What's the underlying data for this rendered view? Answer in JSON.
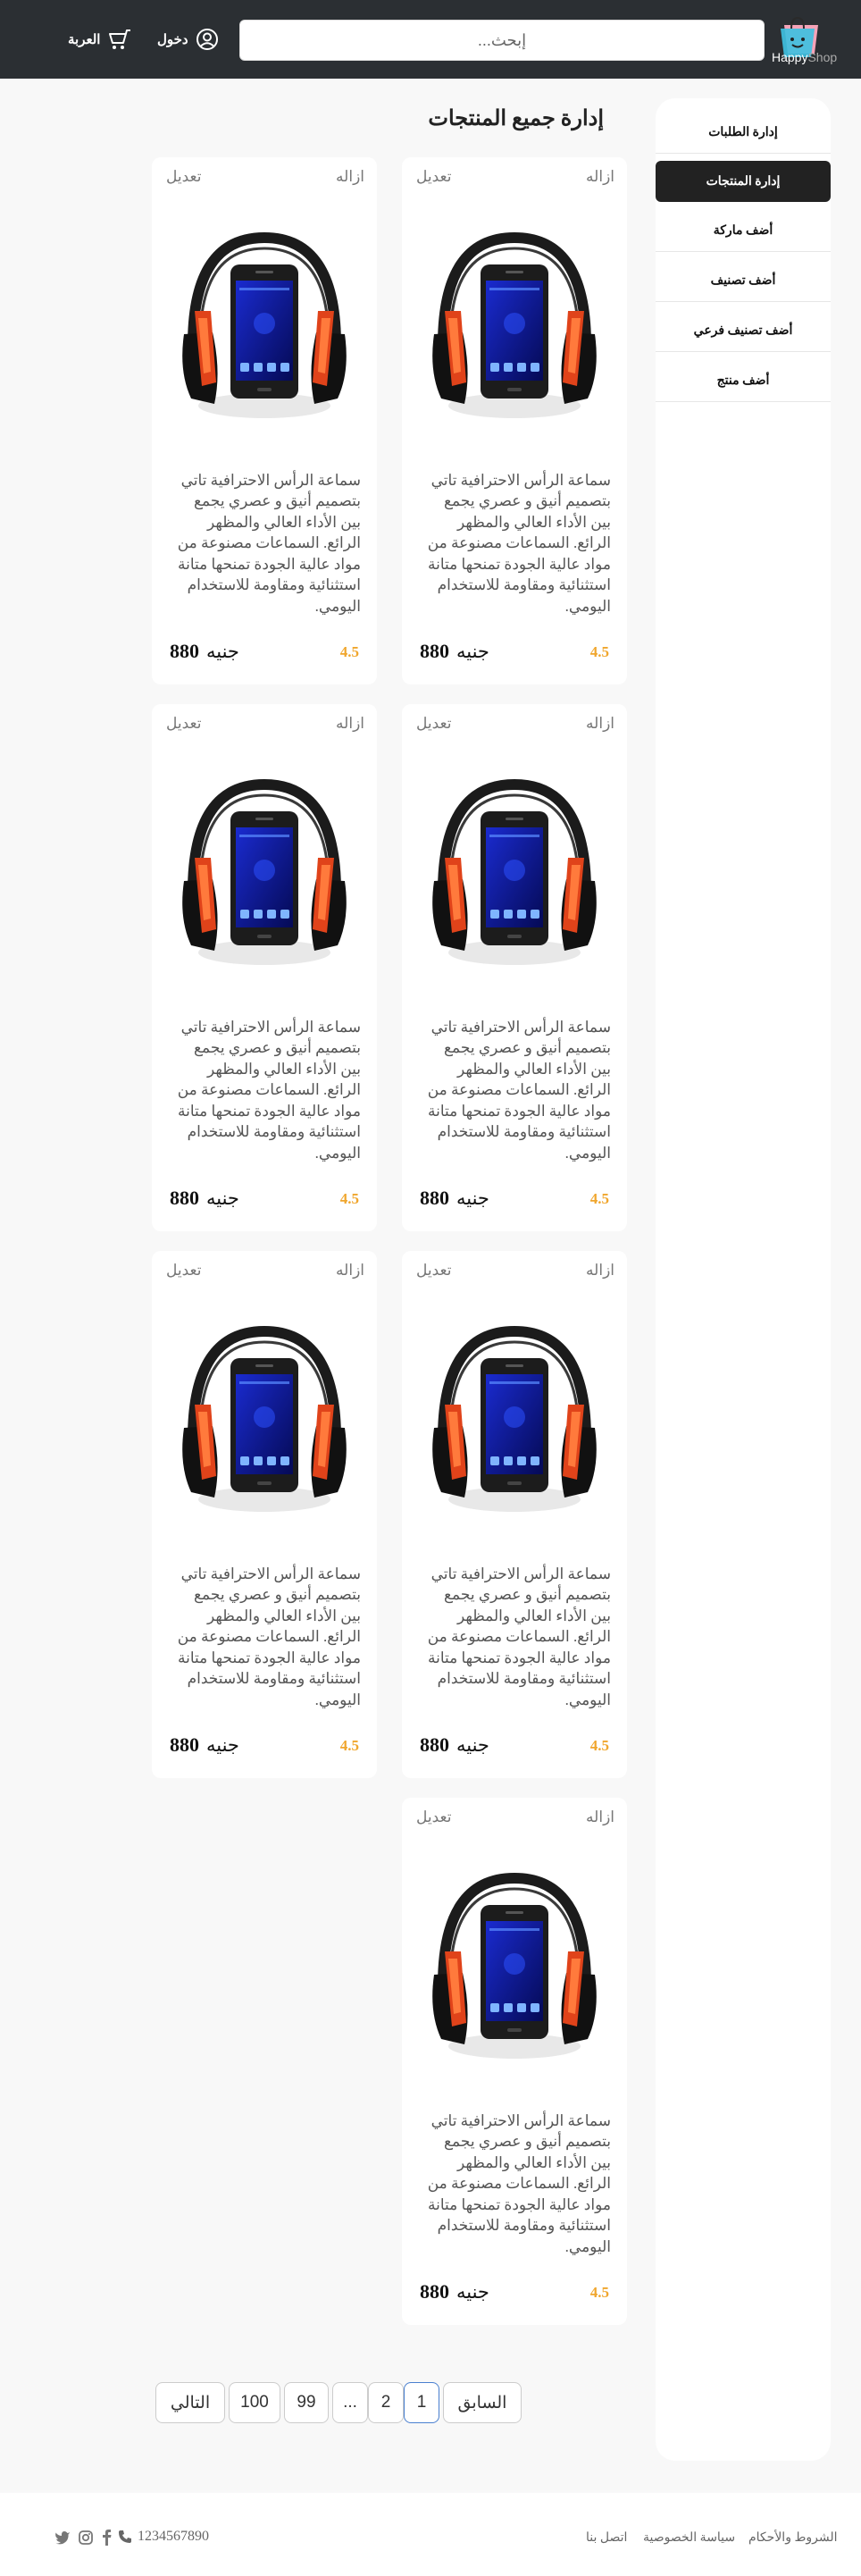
{
  "header": {
    "logo": {
      "happy": "Happy",
      "shop": "Shop"
    },
    "search_placeholder": "إبحث...",
    "login_label": "دخول",
    "cart_label": "العربة"
  },
  "sidebar": {
    "items": [
      {
        "label": "إدارة الطلبات"
      },
      {
        "label": "إدارة المنتجات",
        "active": true
      },
      {
        "label": "أضف ماركة"
      },
      {
        "label": "أضف تصنيف"
      },
      {
        "label": "أضف تصنيف فرعي"
      },
      {
        "label": "أضف منتج"
      }
    ]
  },
  "page": {
    "title": "إدارة جميع المنتجات"
  },
  "product_card": {
    "remove_label": "ازاله",
    "edit_label": "تعديل",
    "description": "سماعة الرأس الاحترافية تاتي بتصميم أنيق و عصري يجمع بين الأداء العالي والمظهر الرائع. السماعات مصنوعة من مواد عالية الجودة تمنحها متانة استثنائية ومقاومة للاستخدام اليومي.",
    "rating": "4.5",
    "price": "880",
    "currency": "جنيه"
  },
  "products": [
    {
      "id": 1
    },
    {
      "id": 2
    },
    {
      "id": 3
    },
    {
      "id": 4
    },
    {
      "id": 5
    },
    {
      "id": 6
    },
    {
      "id": 7
    }
  ],
  "pagination": {
    "prev": "السابق",
    "pages": [
      "1",
      "2",
      "...",
      "99",
      "100"
    ],
    "current": "1",
    "next": "التالي"
  },
  "footer": {
    "terms": "الشروط والأحكام",
    "privacy": "سياسة الخصوصية",
    "contact": "اتصل بنا",
    "phone": "1234567890"
  },
  "colors": {
    "header_bg": "#2b2f33",
    "rating": "#f0a62d",
    "active_page_border": "#4a80d0"
  }
}
